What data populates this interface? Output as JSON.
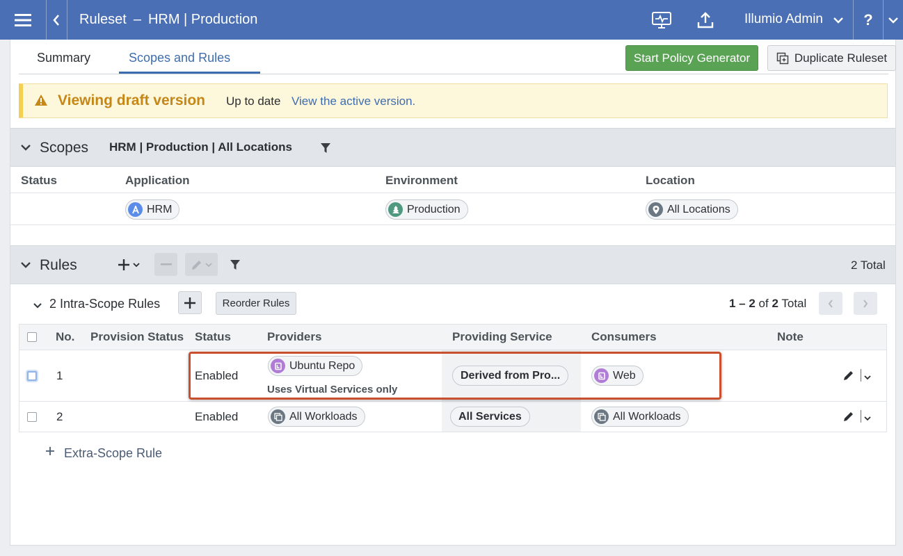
{
  "header": {
    "title": "Ruleset",
    "separator": "–",
    "ruleset_name": "HRM | Production",
    "user": "Illumio Admin",
    "help": "?"
  },
  "tabs": [
    {
      "label": "Summary",
      "active": false
    },
    {
      "label": "Scopes and Rules",
      "active": true
    }
  ],
  "actions": {
    "policy_generator": "Start Policy Generator",
    "duplicate": "Duplicate Ruleset"
  },
  "banner": {
    "title": "Viewing draft version",
    "status": "Up to date",
    "link": "View the active version."
  },
  "scopes": {
    "title": "Scopes",
    "summary": "HRM | Production | All Locations",
    "columns": [
      "Status",
      "Application",
      "Environment",
      "Location"
    ],
    "row": {
      "application": "HRM",
      "environment": "Production",
      "location": "All Locations"
    }
  },
  "rules": {
    "title": "Rules",
    "total": "2 Total",
    "intra_scope_label": "2 Intra-Scope Rules",
    "reorder": "Reorder Rules",
    "pagination": {
      "range": "1 – 2",
      "of": "of",
      "count": "2",
      "total": "Total"
    },
    "columns": [
      "No.",
      "Provision Status",
      "Status",
      "Providers",
      "Providing Service",
      "Consumers",
      "Note"
    ],
    "rows": [
      {
        "no": "1",
        "status": "Enabled",
        "provider": "Ubuntu Repo",
        "provider_note": "Uses Virtual Services only",
        "service": "Derived from Pro...",
        "consumer": "Web"
      },
      {
        "no": "2",
        "status": "Enabled",
        "provider": "All Workloads",
        "provider_note": "",
        "service": "All Services",
        "consumer": "All Workloads"
      }
    ],
    "extra_scope": "Extra-Scope Rule"
  },
  "colors": {
    "header_bg": "#4a6fb5",
    "accent": "#3d6db1",
    "primary_green": "#5aa354",
    "warning": "#c58718",
    "highlight_border": "#c9502e",
    "app_label": "#5b8de8",
    "env_label": "#4f9980",
    "loc_label": "#6b7782",
    "vs_label": "#b07cd6"
  },
  "icons": [
    "menu-icon",
    "back-chevron-icon",
    "monitor-icon",
    "upload-icon",
    "chevron-down-icon",
    "help-icon",
    "warning-icon",
    "filter-icon",
    "plus-icon",
    "minus-icon",
    "pencil-icon",
    "duplicate-icon",
    "application-label-icon",
    "environment-label-icon",
    "location-label-icon",
    "virtual-service-icon",
    "workloads-icon",
    "chevron-left-icon",
    "chevron-right-icon"
  ]
}
